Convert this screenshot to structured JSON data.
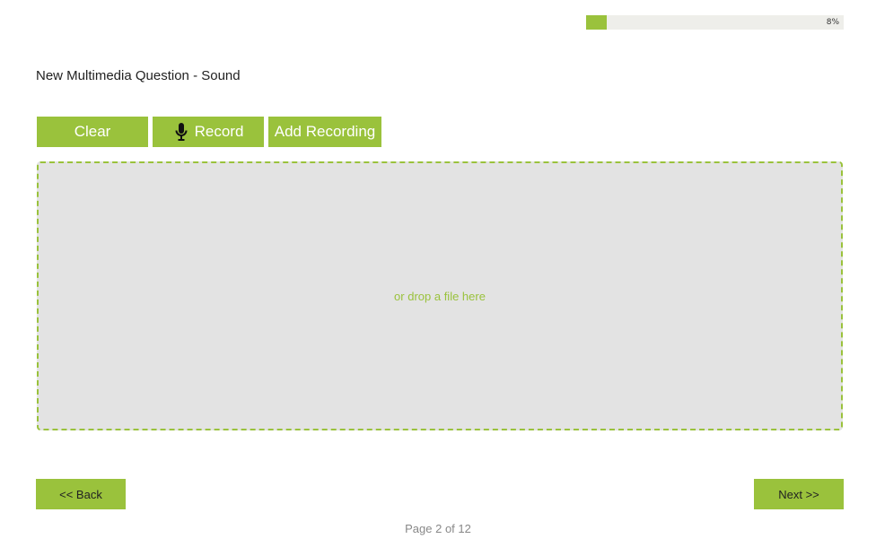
{
  "progress": {
    "percent": 8,
    "label": "8%"
  },
  "question": {
    "title": "New Multimedia Question - Sound"
  },
  "toolbar": {
    "clear_label": "Clear",
    "record_label": "Record",
    "record_icon": "microphone-icon",
    "add_recording_label": "Add Recording"
  },
  "dropzone": {
    "text": "or drop a file here"
  },
  "navigation": {
    "back_label": "<< Back",
    "next_label": "Next >>",
    "page_indicator": "Page 2 of 12"
  },
  "colors": {
    "accent": "#9ac23c",
    "dropzone_bg": "#e3e3e3",
    "progress_track": "#eeeeea"
  }
}
